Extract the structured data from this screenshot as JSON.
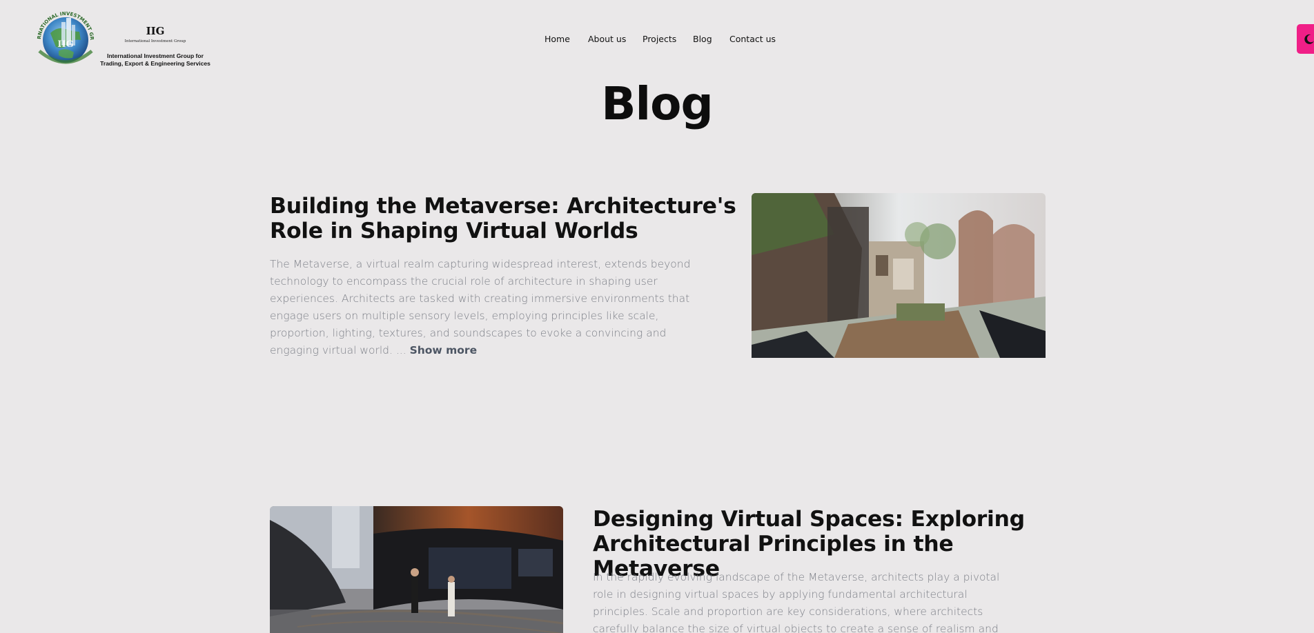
{
  "header": {
    "logo": {
      "abbr": "IIG",
      "subtitle": "International Investment Group",
      "tagline_line1": "International Investment Group for",
      "tagline_line2": "Trading, Export & Engineering Services",
      "seal_text": "INTERNATIONAL INVESTMENT GROUP"
    },
    "nav": {
      "home": "Home",
      "about": "About us",
      "projects": "Projects",
      "blog": "Blog",
      "contact": "Contact us"
    },
    "theme_toggle_icon": "moon-icon",
    "accent_color": "#f01f87"
  },
  "page": {
    "title": "Blog"
  },
  "posts": [
    {
      "title": "Building the Metaverse: Architecture's Role in Shaping Virtual Worlds",
      "excerpt": "The Metaverse, a virtual realm capturing widespread interest, extends beyond technology to encompass the crucial role of architecture in shaping user experiences. Architects are tasked with creating immersive environments that engage users on multiple sensory levels, employing principles like scale, proportion, lighting, textures, and soundscapes to evoke a convincing and engaging virtual world. ...",
      "show_more": "Show more",
      "image_alt": "virtual architecture rendering"
    },
    {
      "title": "Designing Virtual Spaces: Exploring Architectural Principles in the Metaverse",
      "excerpt": "In the rapidly evolving landscape of the Metaverse, architects play a pivotal role in designing virtual spaces by applying fundamental architectural principles. Scale and proportion are key considerations, where architects carefully balance the size of virtual objects to create a sense of realism and coherence, enhancing the overall immersive",
      "image_alt": "virtual reality gallery"
    }
  ]
}
